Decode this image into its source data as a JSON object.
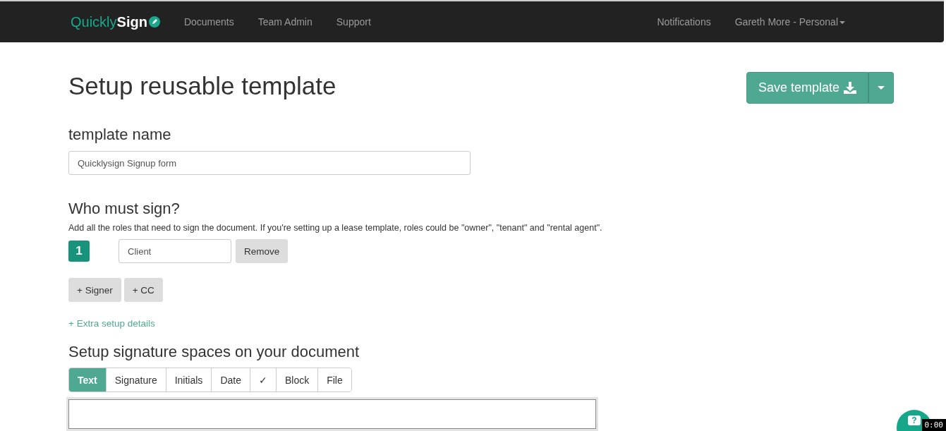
{
  "navbar": {
    "logo": {
      "part_1": "Quickly",
      "part_2": "Sign"
    },
    "links": [
      {
        "label": "Documents"
      },
      {
        "label": "Team Admin"
      },
      {
        "label": "Support"
      }
    ],
    "right_links": [
      {
        "label": "Notifications",
        "kind": "link"
      },
      {
        "label": "Gareth More - Personal",
        "kind": "dropdown"
      }
    ]
  },
  "title": "Setup reusable template",
  "save_button": {
    "label": "Save template"
  },
  "template_name": {
    "heading": "template name",
    "value": "Quicklysign Signup form"
  },
  "signers": {
    "heading": "Who must sign?",
    "description": "Add all the roles that need to sign the document. If you're setting up a lease template, roles could be \"owner\", \"tenant\" and \"rental agent\".",
    "roles": [
      {
        "number": "1",
        "value": "Client",
        "remove": "Remove"
      }
    ],
    "add_buttons": [
      {
        "label": "+ Signer"
      },
      {
        "label": "+ CC"
      }
    ],
    "extra_link": "+ Extra setup details"
  },
  "signature_spaces": {
    "heading": "Setup signature spaces on your document",
    "tabs": [
      {
        "label": "Text",
        "selected": true
      },
      {
        "label": "Signature",
        "selected": false
      },
      {
        "label": "Initials",
        "selected": false
      },
      {
        "label": "Date",
        "selected": false
      },
      {
        "label": "✓",
        "selected": false
      },
      {
        "label": "Block",
        "selected": false
      },
      {
        "label": "File",
        "selected": false
      }
    ]
  },
  "help_widget": {
    "label": "?",
    "timer": "0:00"
  }
}
